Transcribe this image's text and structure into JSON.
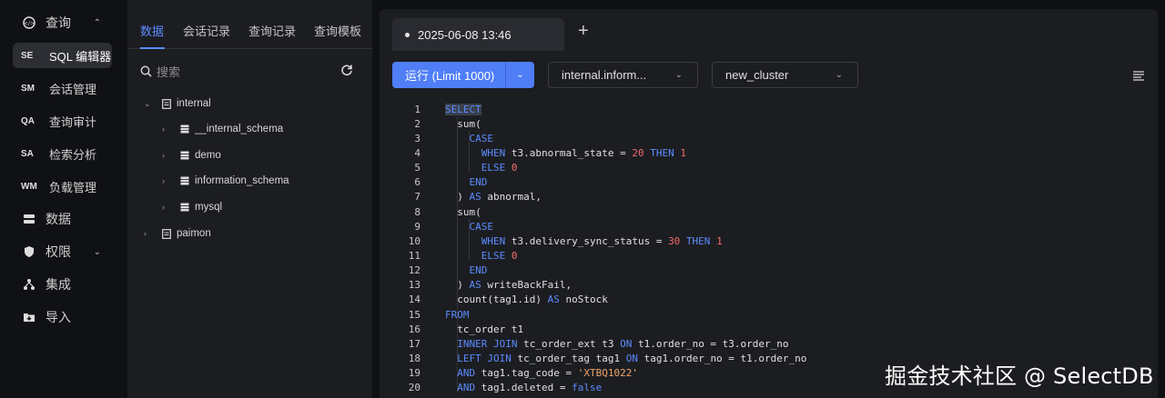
{
  "nav": {
    "query": {
      "label": "查询",
      "icon": "query-icon"
    },
    "items": [
      {
        "abbr": "SE",
        "label": "SQL 编辑器"
      },
      {
        "abbr": "SM",
        "label": "会话管理"
      },
      {
        "abbr": "QA",
        "label": "查询审计"
      },
      {
        "abbr": "SA",
        "label": "检索分析"
      },
      {
        "abbr": "WM",
        "label": "负载管理"
      }
    ],
    "data": {
      "label": "数据",
      "icon": "database-icon"
    },
    "perm": {
      "label": "权限",
      "icon": "shield-icon"
    },
    "integ": {
      "label": "集成",
      "icon": "integration-icon"
    },
    "import": {
      "label": "导入",
      "icon": "import-icon"
    }
  },
  "tree_tabs": [
    "数据",
    "会话记录",
    "查询记录",
    "查询模板"
  ],
  "search": {
    "placeholder": "搜索"
  },
  "tree": {
    "internal": "internal",
    "children": [
      "__internal_schema",
      "demo",
      "information_schema",
      "mysql"
    ],
    "paimon": "paimon"
  },
  "editor": {
    "tab_title": "2025-06-08 13:46",
    "run_label": "运行 (Limit 1000)",
    "catalog_select": "internal.inform...",
    "cluster_select": "new_cluster"
  },
  "code_lines": [
    "SELECT",
    "  sum(",
    "    CASE",
    "      WHEN t3.abnormal_state = 20 THEN 1",
    "      ELSE 0",
    "    END",
    "  ) AS abnormal,",
    "  sum(",
    "    CASE",
    "      WHEN t3.delivery_sync_status = 30 THEN 1",
    "      ELSE 0",
    "    END",
    "  ) AS writeBackFail,",
    "  count(tag1.id) AS noStock",
    "FROM",
    "  tc_order t1",
    "  INNER JOIN tc_order_ext t3 ON t1.order_no = t3.order_no",
    "  LEFT JOIN tc_order_tag tag1 ON tag1.order_no = t1.order_no",
    "  AND tag1.tag_code = 'XTBQ1022'",
    "  AND tag1.deleted = false"
  ],
  "watermark": "掘金技术社区 @ SelectDB",
  "colors": {
    "accent": "#4f7ef7",
    "keyword": "#5b8cff",
    "number": "#f26d6d",
    "string": "#f0a46a"
  }
}
